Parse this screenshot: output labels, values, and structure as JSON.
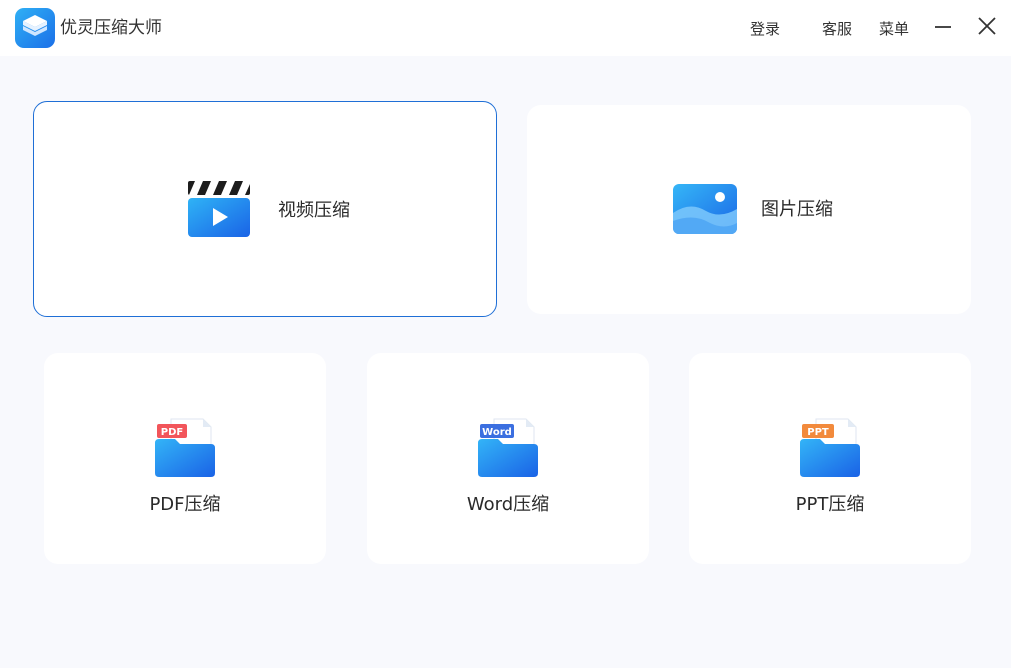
{
  "app": {
    "title": "优灵压缩大师"
  },
  "titlebar": {
    "login_label": "登录",
    "service_label": "客服",
    "menu_label": "菜单"
  },
  "cards": {
    "video": {
      "label": "视频压缩",
      "selected": true
    },
    "image": {
      "label": "图片压缩"
    },
    "pdf": {
      "label": "PDF压缩",
      "tag": "PDF"
    },
    "word": {
      "label": "Word压缩",
      "tag": "Word"
    },
    "ppt": {
      "label": "PPT压缩",
      "tag": "PPT"
    }
  },
  "colors": {
    "accent": "#1f6fd6",
    "pdf_tag": "#f2555a",
    "word_tag": "#3b6fe0",
    "ppt_tag": "#f28a3c"
  },
  "icons": {
    "logo": "layers-logo-icon",
    "minimize": "minimize-icon",
    "close": "close-icon",
    "video": "video-clapper-icon",
    "image": "image-landscape-icon",
    "pdf": "pdf-folder-icon",
    "word": "word-folder-icon",
    "ppt": "ppt-folder-icon"
  }
}
